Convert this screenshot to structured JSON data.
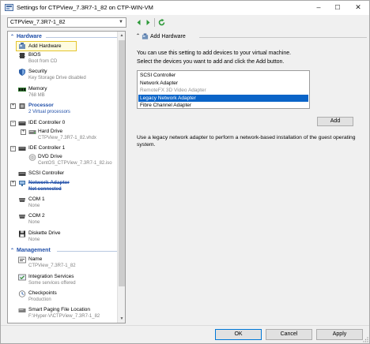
{
  "window": {
    "title": "Settings for CTPView_7.3R7-1_82 on CTP-WIN-VM",
    "icon": "settings-app-icon",
    "controls": {
      "minimize": "–",
      "maximize": "☐",
      "close": "✕"
    }
  },
  "vm_selector": {
    "value": "CTPView_7.3R7-1_82"
  },
  "nav": {
    "back": "back-arrow-icon",
    "forward": "forward-arrow-icon",
    "refresh": "refresh-icon"
  },
  "tree": {
    "hardware_header": "Hardware",
    "add_hardware": "Add Hardware",
    "bios": {
      "label": "BIOS",
      "sub": "Boot from CD"
    },
    "security": {
      "label": "Security",
      "sub": "Key Storage Drive disabled"
    },
    "memory": {
      "label": "Memory",
      "sub": "768 MB"
    },
    "processor": {
      "label": "Processor",
      "sub": "2 Virtual processors"
    },
    "ide0": {
      "label": "IDE Controller 0"
    },
    "hard_drive": {
      "label": "Hard Drive",
      "sub": "CTPView_7.3R7-1_82.vhdx"
    },
    "ide1": {
      "label": "IDE Controller 1"
    },
    "dvd_drive": {
      "label": "DVD Drive",
      "sub": "CentOS_CTPView_7.3R7-1_82.iso"
    },
    "scsi": {
      "label": "SCSI Controller"
    },
    "network_adapter": {
      "label": "Network Adapter",
      "sub": "Not connected"
    },
    "com1": {
      "label": "COM 1",
      "sub": "None"
    },
    "com2": {
      "label": "COM 2",
      "sub": "None"
    },
    "diskette": {
      "label": "Diskette Drive",
      "sub": "None"
    },
    "management_header": "Management",
    "name": {
      "label": "Name",
      "sub": "CTPView_7.3R7-1_82"
    },
    "integration": {
      "label": "Integration Services",
      "sub": "Some services offered"
    },
    "checkpoints": {
      "label": "Checkpoints",
      "sub": "Production"
    },
    "paging": {
      "label": "Smart Paging File Location",
      "sub": "F:\\Hyper-V\\CTPView_7.3R7-1_82"
    }
  },
  "panel": {
    "header": "Add Hardware",
    "desc1": "You can use this setting to add devices to your virtual machine.",
    "desc2": "Select the devices you want to add and click the Add button.",
    "devices": [
      "SCSI Controller",
      "Network Adapter",
      "RemoteFX 3D Video Adapter",
      "Legacy Network Adapter",
      "Fibre Channel Adapter"
    ],
    "add_button": "Add",
    "hint": "Use a legacy network adapter to perform a network-based installation of the guest operating system."
  },
  "footer": {
    "ok": "OK",
    "cancel": "Cancel",
    "apply": "Apply"
  },
  "colors": {
    "accent": "#1f4ea8",
    "selection": "#0a64c8",
    "highlight_border": "#e4c52d"
  }
}
